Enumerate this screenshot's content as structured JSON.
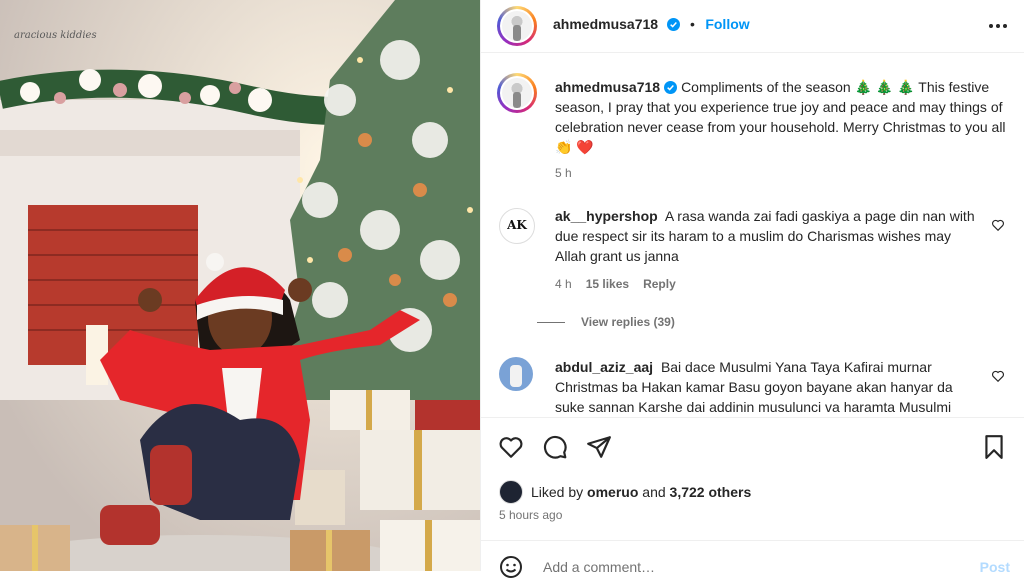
{
  "photo": {
    "watermark": "aracious kiddies"
  },
  "header": {
    "username": "ahmedmusa718",
    "separator": "•",
    "follow_label": "Follow"
  },
  "caption": {
    "username": "ahmedmusa718",
    "text": "Compliments of the season 🎄 🎄 🎄  This festive season, I pray that you experience true joy and peace and may things of celebration never cease from your household. Merry Christmas to you all 👏 ❤️",
    "time": "5 h"
  },
  "comments": [
    {
      "username": "ak__hypershop",
      "text": "A rasa wanda zai fadi gaskiya a page din nan with due respect sir its haram to a muslim do Charismas wishes may Allah grant us janna",
      "time": "4 h",
      "likes": "15 likes",
      "reply_label": "Reply",
      "view_replies": "View replies (39)",
      "avatar_text": "AK"
    },
    {
      "username": "abdul_aziz_aaj",
      "text": "Bai dace Musulmi Yana Taya Kafirai murnar Christmas ba Hakan kamar Basu goyon bayane akan hanyar da suke sannan Karshe dai addinin musulunci va haramta Musulmi"
    }
  ],
  "likes": {
    "prefix": "Liked by",
    "user": "omeruo",
    "and": "and",
    "count": "3,722 others"
  },
  "post_time": "5 hours ago",
  "add_comment": {
    "placeholder": "Add a comment…",
    "post_label": "Post"
  }
}
